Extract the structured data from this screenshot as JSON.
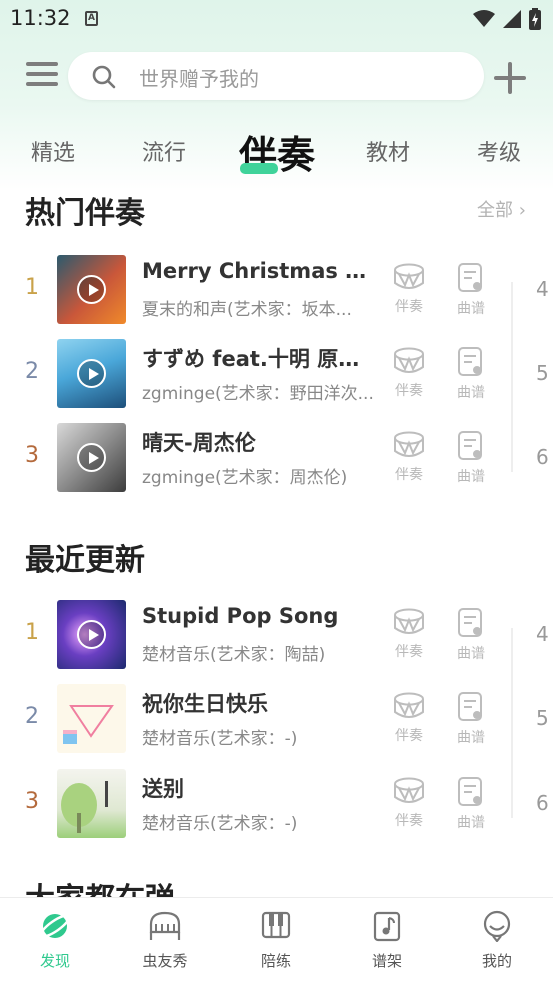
{
  "status_bar": {
    "time": "11:32",
    "notification_letter": "A"
  },
  "search": {
    "placeholder": "世界赠予我的"
  },
  "tabs": [
    {
      "label": "精选"
    },
    {
      "label": "流行"
    },
    {
      "label": "伴奏",
      "active": true
    },
    {
      "label": "教材"
    },
    {
      "label": "考级"
    }
  ],
  "hot_section": {
    "title": "热门伴奏",
    "see_all": "全部",
    "items": [
      {
        "rank": "1",
        "title": "Merry Christmas Mr....",
        "subtitle": "夏末的和声(艺术家：坂本...",
        "side_number": "4"
      },
      {
        "rank": "2",
        "title": "すずめ feat.十明 原版...",
        "subtitle": "zgminge(艺术家：野田洋次...",
        "side_number": "5"
      },
      {
        "rank": "3",
        "title": "晴天-周杰伦",
        "subtitle": "zgminge(艺术家：周杰伦)",
        "side_number": "6"
      }
    ]
  },
  "recent_section": {
    "title": "最近更新",
    "items": [
      {
        "rank": "1",
        "title": "Stupid Pop Song",
        "subtitle": "楚材音乐(艺术家：陶喆)",
        "side_number": "4"
      },
      {
        "rank": "2",
        "title": "祝你生日快乐",
        "subtitle": "楚材音乐(艺术家：-)",
        "side_number": "5"
      },
      {
        "rank": "3",
        "title": "送别",
        "subtitle": "楚材音乐(艺术家：-)",
        "side_number": "6"
      }
    ]
  },
  "row_actions": {
    "accompaniment": "伴奏",
    "score": "曲谱"
  },
  "next_section_title": "大家都在弹",
  "bottom_nav": [
    {
      "label": "发现",
      "icon": "planet-icon",
      "active": true
    },
    {
      "label": "虫友秀",
      "icon": "piano-icon"
    },
    {
      "label": "陪练",
      "icon": "keys-icon"
    },
    {
      "label": "谱架",
      "icon": "music-note-icon"
    },
    {
      "label": "我的",
      "icon": "profile-icon"
    }
  ],
  "colors": {
    "accent": "#2fc98e",
    "rank_gold": "#c9a24a",
    "rank_blue": "#7a8aa8",
    "rank_bronze": "#b46a3c"
  }
}
